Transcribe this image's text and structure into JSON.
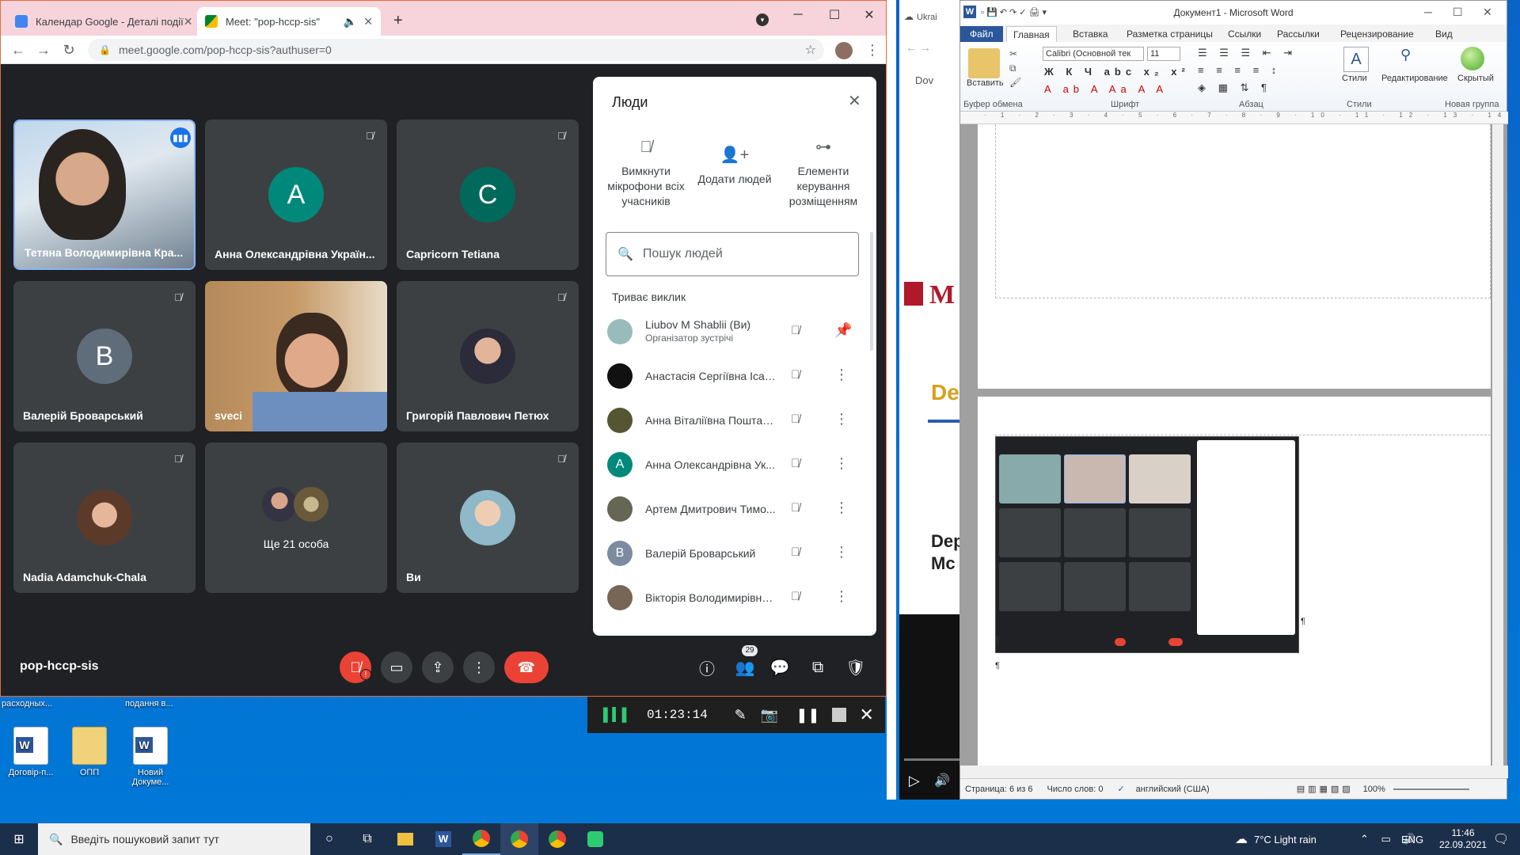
{
  "chrome": {
    "tab1": "Календар Google - Деталі події",
    "tab2": "Meet: \"pop-hccp-sis\"",
    "url": "meet.google.com/pop-hccp-sis?authuser=0"
  },
  "meet": {
    "tiles": [
      {
        "name": "Тетяна Володимирівна Кра...",
        "type": "video"
      },
      {
        "name": "Анна Олександрівна Україн...",
        "letter": "A",
        "color": "#00897b"
      },
      {
        "name": "Capricorn Tetiana",
        "letter": "C",
        "color": "#00695c"
      },
      {
        "name": "Валерій Броварський",
        "letter": "B",
        "color": "#5f6d7a"
      },
      {
        "name": "sveci",
        "type": "video"
      },
      {
        "name": "Григорій Павлович Петюх",
        "type": "photo"
      },
      {
        "name": "Nadia Adamchuk-Chala",
        "type": "photo"
      },
      {
        "name": "Ще 21 особа",
        "type": "more"
      },
      {
        "name": "Ви",
        "type": "photo"
      }
    ],
    "meeting_code": "pop-hccp-sis",
    "participants_count": "29"
  },
  "people_panel": {
    "title": "Люди",
    "actions": [
      "Вимкнути мікрофони всіх учасників",
      "Додати людей",
      "Елементи керування розміщенням"
    ],
    "search_placeholder": "Пошук людей",
    "section": "Триває виклик",
    "rows": [
      {
        "name": "Liubov M Shablii (Ви)",
        "sub": "Організатор зустрічі",
        "color": "#8aa"
      },
      {
        "name": "Анастасія Сергіївна Ісає...",
        "color": "#111"
      },
      {
        "name": "Анна Віталіївна Поштаре...",
        "color": "#553"
      },
      {
        "name": "Анна Олександрівна Ук...",
        "letter": "A",
        "color": "#00897b"
      },
      {
        "name": "Артем Дмитрович Тимо...",
        "color": "#665"
      },
      {
        "name": "Валерій Броварський",
        "letter": "B",
        "color": "#5f6d7a"
      },
      {
        "name": "Вікторія Володимирівна ...",
        "color": "#765"
      }
    ]
  },
  "recorder": {
    "time": "01:23:14"
  },
  "desktop": {
    "label_top1": "расходных...",
    "label_top2": "подання в...",
    "icons": [
      "Договір-п...",
      "ОПП",
      "Новий Докуме..."
    ]
  },
  "taskbar": {
    "search": "Введіть пошуковий запит тут",
    "weather": "7°C  Light rain",
    "lang": "ENG",
    "time": "11:46",
    "date": "22.09.2021"
  },
  "word": {
    "title": "Документ1 - Microsoft Word",
    "tabs": [
      "Файл",
      "Главная",
      "Вставка",
      "Разметка страницы",
      "Ссылки",
      "Рассылки",
      "Рецензирование",
      "Вид"
    ],
    "font": "Calibri (Основной тек",
    "size": "11",
    "groups": [
      "Буфер обмена",
      "Шрифт",
      "Абзац",
      "Стили",
      "Новая группа"
    ],
    "paste": "Вставить",
    "styles": "Стили",
    "editing": "Редактирование",
    "hidden": "Скрытый",
    "status_page": "Страница: 6 из 6",
    "status_words": "Число слов: 0",
    "status_lang": "английский (США)",
    "zoom": "100%"
  },
  "behind": {
    "t1": "Ukrai",
    "t2": "Dov",
    "t3": "De",
    "t4": "Dep",
    "t5": "Mc"
  }
}
